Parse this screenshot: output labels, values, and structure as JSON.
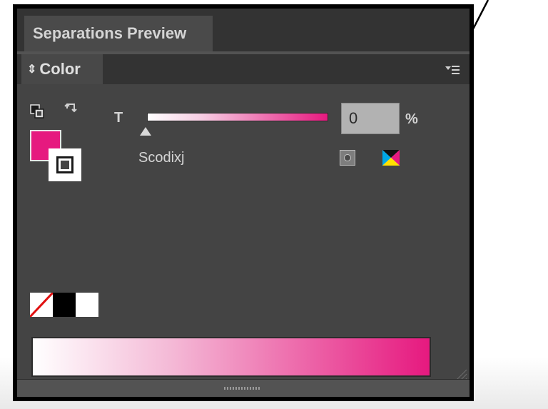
{
  "tabs": {
    "separations_preview": "Separations Preview",
    "color": "Color"
  },
  "color_panel": {
    "tint_label": "T",
    "tint_value": "0",
    "percent_symbol": "%",
    "tint_fraction": 0,
    "swatch_name": "Scodixj",
    "fill_color": "#e6197f",
    "ramp_end_color": "#e6197f",
    "quick_swatches": [
      "none",
      "black",
      "white"
    ]
  },
  "icons": {
    "default_colors": "default-fill-stroke-icon",
    "swap": "swap-fill-stroke-icon",
    "spot": "spot-color-icon",
    "cmyk": "process-cmyk-icon",
    "menu": "panel-menu-icon",
    "collapse": "collapse-chevron-icon"
  }
}
